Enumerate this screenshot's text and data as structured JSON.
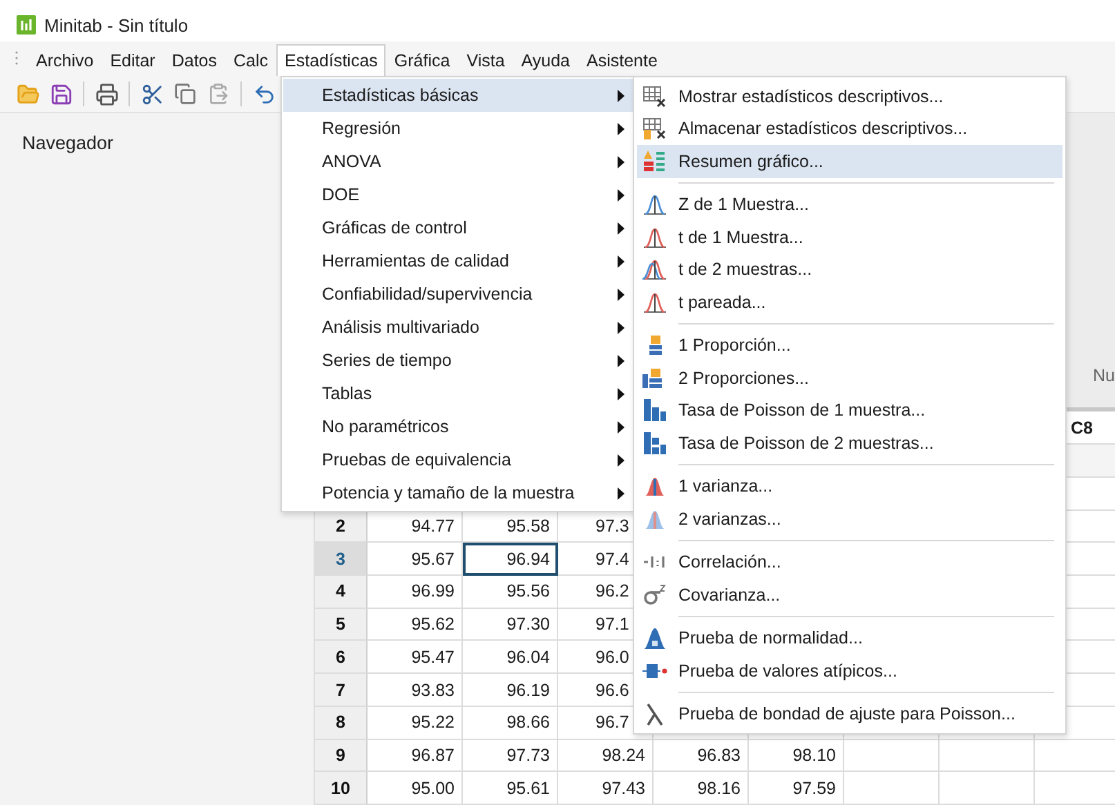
{
  "window": {
    "title": "Minitab - Sin título"
  },
  "menubar": [
    {
      "label": "Archivo",
      "selected": false
    },
    {
      "label": "Editar",
      "selected": false
    },
    {
      "label": "Datos",
      "selected": false
    },
    {
      "label": "Calc",
      "selected": false
    },
    {
      "label": "Estadísticas",
      "selected": true
    },
    {
      "label": "Gráfica",
      "selected": false
    },
    {
      "label": "Vista",
      "selected": false
    },
    {
      "label": "Ayuda",
      "selected": false
    },
    {
      "label": "Asistente",
      "selected": false
    }
  ],
  "navigator": {
    "title": "Navegador"
  },
  "start_page": {
    "caption": "Nu"
  },
  "worksheet": {
    "headers": [
      "C8"
    ],
    "rows": [
      {
        "label": "2",
        "selected": false,
        "cells": [
          {
            "text": "94.77",
            "selected": false
          },
          {
            "text": "95.58",
            "selected": false
          },
          {
            "text": "97.3",
            "selected": false
          }
        ]
      },
      {
        "label": "3",
        "selected": true,
        "cells": [
          {
            "text": "95.67",
            "selected": false
          },
          {
            "text": "96.94",
            "selected": true
          },
          {
            "text": "97.4",
            "selected": false
          }
        ]
      },
      {
        "label": "4",
        "selected": false,
        "cells": [
          {
            "text": "96.99",
            "selected": false
          },
          {
            "text": "95.56",
            "selected": false
          },
          {
            "text": "96.2",
            "selected": false
          }
        ]
      },
      {
        "label": "5",
        "selected": false,
        "cells": [
          {
            "text": "95.62",
            "selected": false
          },
          {
            "text": "97.30",
            "selected": false
          },
          {
            "text": "97.1",
            "selected": false
          }
        ]
      },
      {
        "label": "6",
        "selected": false,
        "cells": [
          {
            "text": "95.47",
            "selected": false
          },
          {
            "text": "96.04",
            "selected": false
          },
          {
            "text": "96.0",
            "selected": false
          }
        ]
      },
      {
        "label": "7",
        "selected": false,
        "cells": [
          {
            "text": "93.83",
            "selected": false
          },
          {
            "text": "96.19",
            "selected": false
          },
          {
            "text": "96.6",
            "selected": false
          }
        ]
      },
      {
        "label": "8",
        "selected": false,
        "cells": [
          {
            "text": "95.22",
            "selected": false
          },
          {
            "text": "98.66",
            "selected": false
          },
          {
            "text": "96.7",
            "selected": false
          }
        ]
      },
      {
        "label": "9",
        "selected": false,
        "cells": [
          {
            "text": "96.87",
            "selected": false
          },
          {
            "text": "97.73",
            "selected": false
          },
          {
            "text": "98.24",
            "selected": false
          },
          {
            "text": "96.83",
            "selected": false
          },
          {
            "text": "98.10",
            "selected": false
          }
        ]
      },
      {
        "label": "10",
        "selected": false,
        "cells": [
          {
            "text": "95.00",
            "selected": false
          },
          {
            "text": "95.61",
            "selected": false
          },
          {
            "text": "97.43",
            "selected": false
          },
          {
            "text": "98.16",
            "selected": false
          },
          {
            "text": "97.59",
            "selected": false
          }
        ]
      }
    ]
  },
  "stat_menu": [
    {
      "label": "Estadísticas básicas",
      "selected": true
    },
    {
      "label": "Regresión",
      "selected": false
    },
    {
      "label": "ANOVA",
      "selected": false
    },
    {
      "label": "DOE",
      "selected": false
    },
    {
      "label": "Gráficas de control",
      "selected": false
    },
    {
      "label": "Herramientas de calidad",
      "selected": false
    },
    {
      "label": "Confiabilidad/supervivencia",
      "selected": false
    },
    {
      "label": "Análisis multivariado",
      "selected": false
    },
    {
      "label": "Series de tiempo",
      "selected": false
    },
    {
      "label": "Tablas",
      "selected": false
    },
    {
      "label": "No paramétricos",
      "selected": false
    },
    {
      "label": "Pruebas de equivalencia",
      "selected": false
    },
    {
      "label": "Potencia y tamaño de la muestra",
      "selected": false
    }
  ],
  "basic_stats_menu": [
    {
      "kind": "item",
      "label": "Mostrar estadísticos descriptivos...",
      "selected": false
    },
    {
      "kind": "item",
      "label": "Almacenar estadísticos descriptivos...",
      "selected": false
    },
    {
      "kind": "item",
      "label": "Resumen gráfico...",
      "selected": true
    },
    {
      "kind": "separator"
    },
    {
      "kind": "item",
      "label": "Z de 1 Muestra...",
      "selected": false
    },
    {
      "kind": "item",
      "label": "t de 1 Muestra...",
      "selected": false
    },
    {
      "kind": "item",
      "label": "t de 2 muestras...",
      "selected": false
    },
    {
      "kind": "item",
      "label": "t pareada...",
      "selected": false
    },
    {
      "kind": "separator"
    },
    {
      "kind": "item",
      "label": "1 Proporción...",
      "selected": false
    },
    {
      "kind": "item",
      "label": "2 Proporciones...",
      "selected": false
    },
    {
      "kind": "item",
      "label": "Tasa de Poisson de 1 muestra...",
      "selected": false
    },
    {
      "kind": "item",
      "label": "Tasa de Poisson de 2 muestras...",
      "selected": false
    },
    {
      "kind": "separator"
    },
    {
      "kind": "item",
      "label": "1 varianza...",
      "selected": false
    },
    {
      "kind": "item",
      "label": "2 varianzas...",
      "selected": false
    },
    {
      "kind": "separator"
    },
    {
      "kind": "item",
      "label": "Correlación...",
      "selected": false
    },
    {
      "kind": "item",
      "label": "Covarianza...",
      "selected": false
    },
    {
      "kind": "separator"
    },
    {
      "kind": "item",
      "label": "Prueba de normalidad...",
      "selected": false
    },
    {
      "kind": "item",
      "label": "Prueba de valores atípicos...",
      "selected": false
    },
    {
      "kind": "separator"
    },
    {
      "kind": "item",
      "label": "Prueba de bondad de ajuste para Poisson...",
      "selected": false
    }
  ]
}
